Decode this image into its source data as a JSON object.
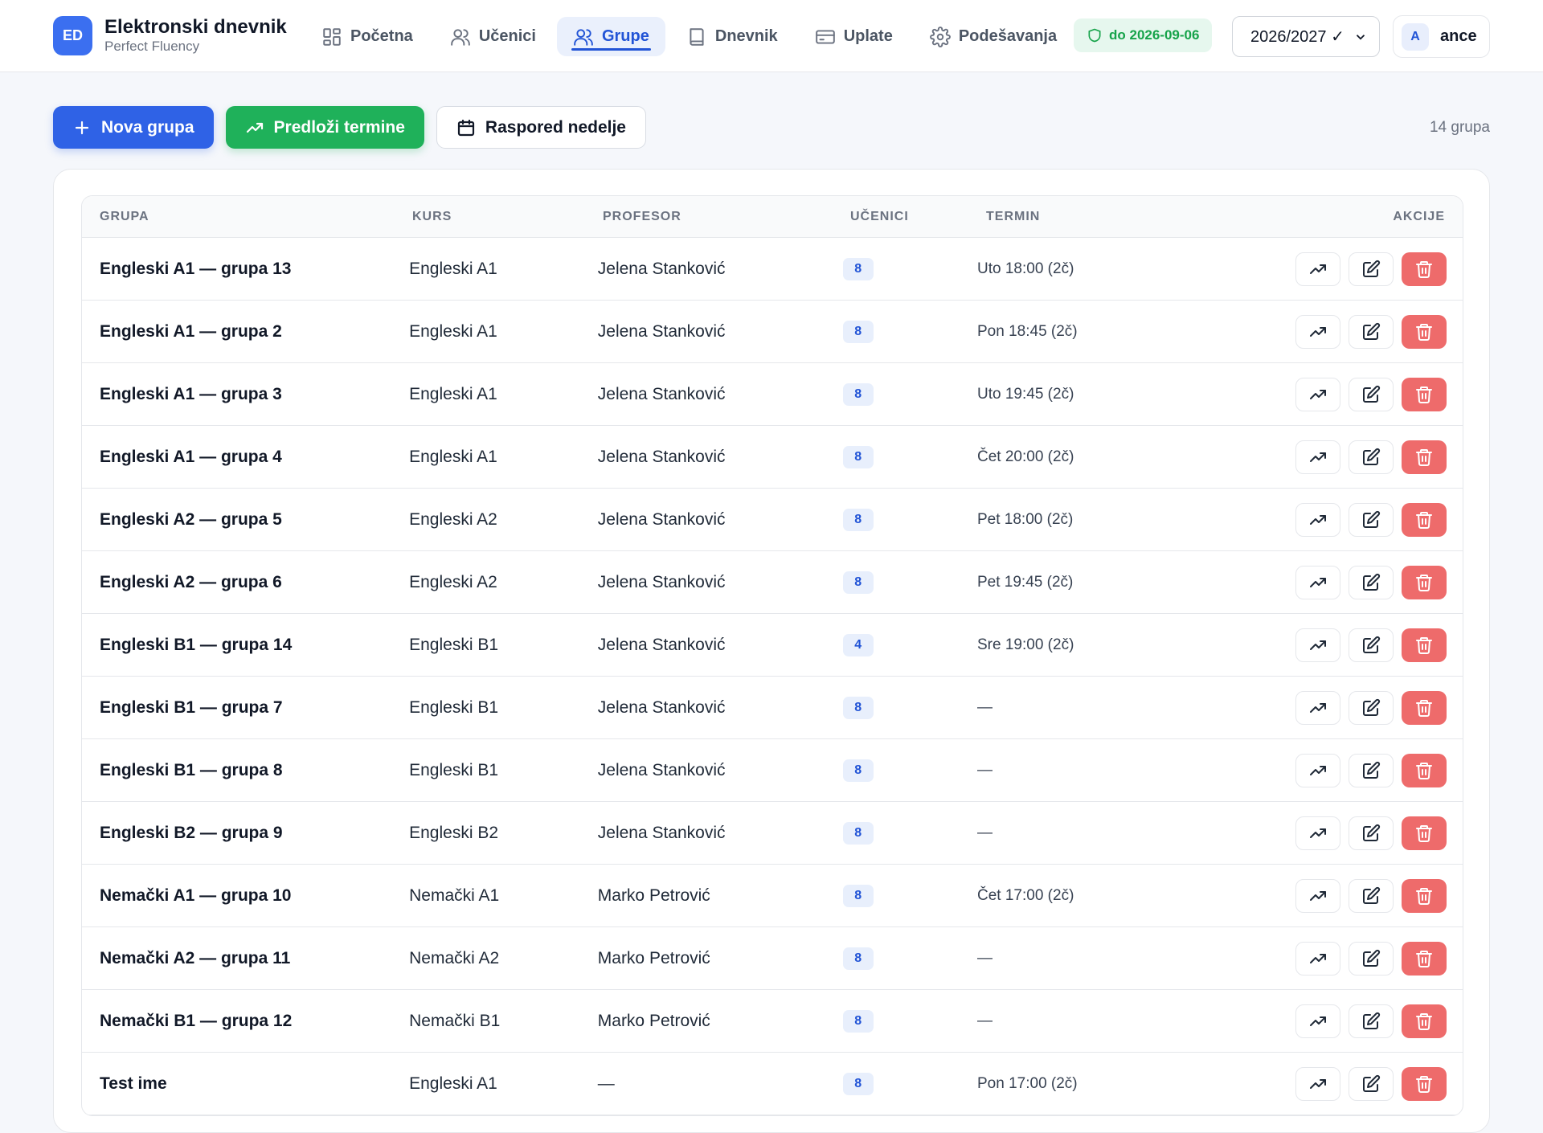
{
  "app": {
    "logo": "ED",
    "title": "Elektronski dnevnik",
    "subtitle": "Perfect Fluency"
  },
  "nav": [
    {
      "label": "Početna",
      "icon": "dashboard-icon",
      "active": false
    },
    {
      "label": "Učenici",
      "icon": "users-icon",
      "active": false
    },
    {
      "label": "Grupe",
      "icon": "group-icon",
      "active": true
    },
    {
      "label": "Dnevnik",
      "icon": "book-icon",
      "active": false
    },
    {
      "label": "Uplate",
      "icon": "credit-card-icon",
      "active": false
    },
    {
      "label": "Podešavanja",
      "icon": "gear-icon",
      "active": false
    }
  ],
  "license": {
    "label": "do 2026-09-06",
    "color": "#16a34a"
  },
  "year_select": {
    "value": "2026/2027 ✓"
  },
  "user": {
    "initial": "A",
    "name": "ance"
  },
  "toolbar": {
    "new_group": "Nova grupa",
    "suggest_terms": "Predloži termine",
    "weekly_schedule": "Raspored nedelje",
    "count": "14 grupa"
  },
  "table": {
    "headers": {
      "group": "GRUPA",
      "course": "KURS",
      "professor": "PROFESOR",
      "students": "UČENICI",
      "term": "TERMIN",
      "actions": "AKCIJE"
    },
    "rows": [
      {
        "group": "Engleski A1 — grupa 13",
        "course": "Engleski A1",
        "professor": "Jelena Stanković",
        "students": "8",
        "term": "Uto 18:00 (2č)"
      },
      {
        "group": "Engleski A1 — grupa 2",
        "course": "Engleski A1",
        "professor": "Jelena Stanković",
        "students": "8",
        "term": "Pon 18:45 (2č)"
      },
      {
        "group": "Engleski A1 — grupa 3",
        "course": "Engleski A1",
        "professor": "Jelena Stanković",
        "students": "8",
        "term": "Uto 19:45 (2č)"
      },
      {
        "group": "Engleski A1 — grupa 4",
        "course": "Engleski A1",
        "professor": "Jelena Stanković",
        "students": "8",
        "term": "Čet 20:00 (2č)"
      },
      {
        "group": "Engleski A2 — grupa 5",
        "course": "Engleski A2",
        "professor": "Jelena Stanković",
        "students": "8",
        "term": "Pet 18:00 (2č)"
      },
      {
        "group": "Engleski A2 — grupa 6",
        "course": "Engleski A2",
        "professor": "Jelena Stanković",
        "students": "8",
        "term": "Pet 19:45 (2č)"
      },
      {
        "group": "Engleski B1 — grupa 14",
        "course": "Engleski B1",
        "professor": "Jelena Stanković",
        "students": "4",
        "term": "Sre 19:00 (2č)"
      },
      {
        "group": "Engleski B1 — grupa 7",
        "course": "Engleski B1",
        "professor": "Jelena Stanković",
        "students": "8",
        "term": "—"
      },
      {
        "group": "Engleski B1 — grupa 8",
        "course": "Engleski B1",
        "professor": "Jelena Stanković",
        "students": "8",
        "term": "—"
      },
      {
        "group": "Engleski B2 — grupa 9",
        "course": "Engleski B2",
        "professor": "Jelena Stanković",
        "students": "8",
        "term": "—"
      },
      {
        "group": "Nemački A1 — grupa 10",
        "course": "Nemački A1",
        "professor": "Marko Petrović",
        "students": "8",
        "term": "Čet 17:00 (2č)"
      },
      {
        "group": "Nemački A2 — grupa 11",
        "course": "Nemački A2",
        "professor": "Marko Petrović",
        "students": "8",
        "term": "—"
      },
      {
        "group": "Nemački B1 — grupa 12",
        "course": "Nemački B1",
        "professor": "Marko Petrović",
        "students": "8",
        "term": "—"
      },
      {
        "group": "Test ime",
        "course": "Engleski A1",
        "professor": "—",
        "students": "8",
        "term": "Pon 17:00 (2č)"
      }
    ]
  },
  "colors": {
    "accent": "#2254d6",
    "primary_button": "#2f62e6",
    "success_button": "#1fb15a",
    "danger": "#ee6b6b"
  }
}
